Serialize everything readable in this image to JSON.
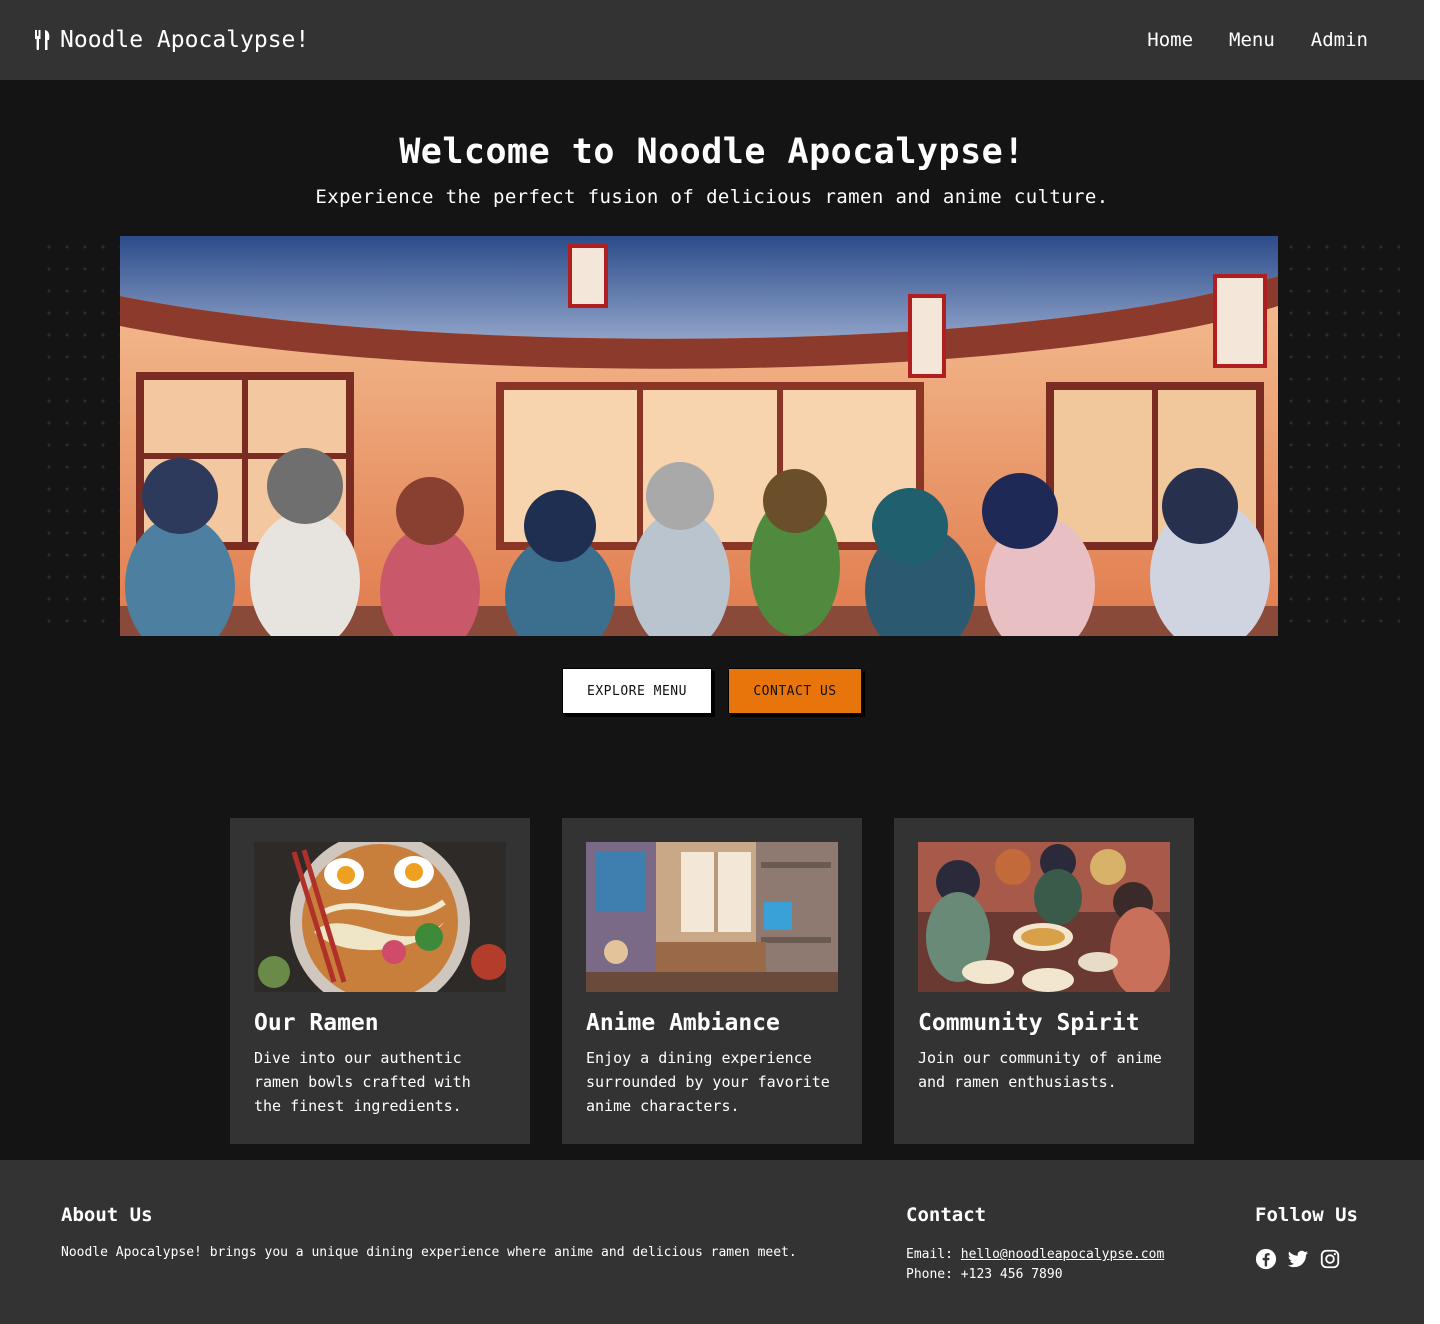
{
  "nav": {
    "brand": "Noodle Apocalypse!",
    "brand_icon": "utensils-icon",
    "links": [
      "Home",
      "Menu",
      "Admin"
    ]
  },
  "hero": {
    "title": "Welcome to Noodle Apocalypse!",
    "subtitle": "Experience the perfect fusion of delicious ramen and anime culture.",
    "explore_button": "EXPLORE MENU",
    "contact_button": "CONTACT US"
  },
  "cards": [
    {
      "title": "Our Ramen",
      "text": "Dive into our authentic ramen bowls crafted with the finest ingredients."
    },
    {
      "title": "Anime Ambiance",
      "text": "Enjoy a dining experience surrounded by your favorite anime characters."
    },
    {
      "title": "Community Spirit",
      "text": "Join our community of anime and ramen enthusiasts."
    }
  ],
  "footer": {
    "about_heading": "About Us",
    "about_text": "Noodle Apocalypse! brings you a unique dining experience where anime and delicious ramen meet.",
    "contact_heading": "Contact",
    "email_label": "Email: ",
    "email": "hello@noodleapocalypse.com",
    "phone": "Phone: +123 456 7890",
    "follow_heading": "Follow Us",
    "social_icons": [
      "facebook-icon",
      "twitter-icon",
      "instagram-icon"
    ]
  },
  "colors": {
    "background": "#141414",
    "panel": "#333333",
    "accent": "#e8740c"
  }
}
